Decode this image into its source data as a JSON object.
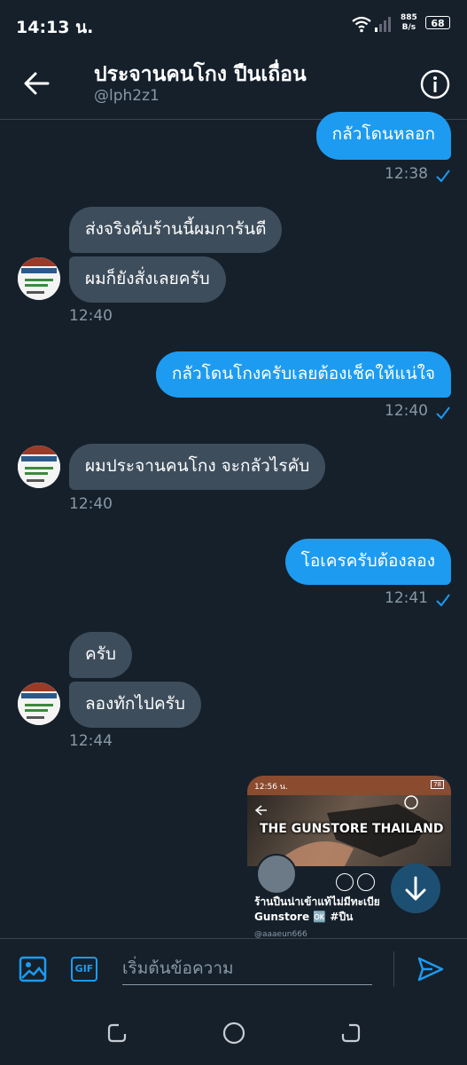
{
  "status_bar": {
    "time": "14:13 น.",
    "speed_value": "885",
    "speed_unit": "B/s",
    "battery": "68"
  },
  "header": {
    "title": "ประจานคนโกง ปืนเถื่อน",
    "handle": "@lph2z1"
  },
  "messages": [
    {
      "dir": "out",
      "text": "กลัวโดนหลอก",
      "time": "12:38"
    },
    {
      "dir": "in",
      "text": "ส่งจริงคับร้านนี้ผมการันตี"
    },
    {
      "dir": "in",
      "text": "ผมก็ยังสั่งเลยครับ",
      "time": "12:40"
    },
    {
      "dir": "out",
      "text": "กลัวโดนโกงครับเลยต้องเช็คให้แน่ใจ",
      "time": "12:40"
    },
    {
      "dir": "in",
      "text": "ผมประจานคนโกง จะกลัวไรคับ",
      "time": "12:40"
    },
    {
      "dir": "out",
      "text": "โอเครครับต้องลอง",
      "time": "12:41"
    },
    {
      "dir": "in",
      "text": "ครับ"
    },
    {
      "dir": "in",
      "text": "ลองทักไปครับ",
      "time": "12:44"
    }
  ],
  "media": {
    "status_time": "12:56 น.",
    "status_battery": "78",
    "banner_title": "THE GUNSTORE THAILAND",
    "text_line1": "ร้านปืนน่าเข้าแท้ไม่มีทะเบีย",
    "text_line2": "Gunstore 🆗 #ปืน",
    "handle": "@aaaeun666"
  },
  "composer": {
    "placeholder": "เริ่มต้นข้อความ",
    "gif_label": "GIF"
  },
  "colors": {
    "background": "#15202b",
    "accent": "#1d9bf0",
    "incoming": "#3d4d5c",
    "muted": "#8899a6"
  }
}
